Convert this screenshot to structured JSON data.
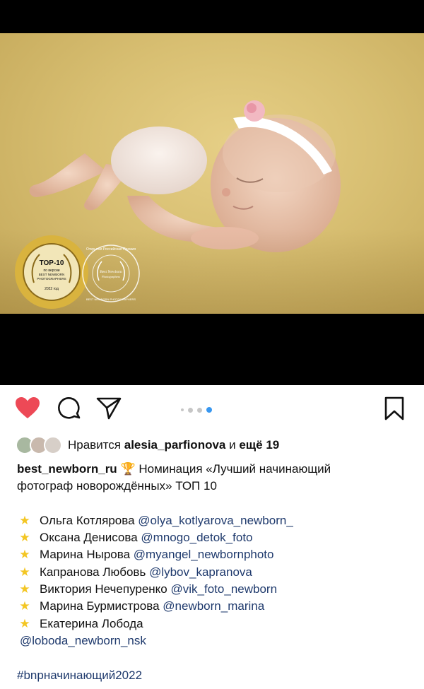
{
  "post": {
    "likes": {
      "prefix": "Нравится",
      "user": "alesia_parfionova",
      "conj": "и",
      "more": "ещё 19"
    },
    "caption": {
      "author": "best_newborn_ru",
      "emoji": "🏆",
      "title_line1": "Номинация «Лучший начинающий",
      "title_line2": "фотограф новорождённых» ТОП 10",
      "entries": [
        {
          "name": "Ольга Котлярова",
          "handle": "@olya_kotlyarova_newborn_"
        },
        {
          "name": "Оксана Денисова",
          "handle": "@mnogo_detok_foto"
        },
        {
          "name": "Марина Нырова",
          "handle": "@myangel_newbornphoto"
        },
        {
          "name": "Капранова Любовь",
          "handle": "@lybov_kapranova"
        },
        {
          "name": "Виктория Нечепуренко",
          "handle": "@vik_foto_newborn"
        },
        {
          "name": "Марина Бурмистрова",
          "handle": "@newborn_marina"
        },
        {
          "name": "Екатерина Лобода",
          "handle": "@loboda_newborn_nsk"
        }
      ],
      "hashtag": "#bnpначинающий2022"
    },
    "photo": {
      "badge_top": "TOP-10",
      "badge_line2": "по версии",
      "badge_line3": "BEST NEWBORN",
      "badge_line4": "PHOTOGRAPHERS",
      "badge_year": "2022 год",
      "seal_arc": "Открытая Российская Премия",
      "seal_center1": "Best Newborn",
      "seal_center2": "Photographers",
      "seal_bottom": "BEST NEWBORN PHOTOGRAPHERS"
    },
    "icons": {
      "like": "heart-icon",
      "comment": "comment-icon",
      "share": "send-icon",
      "save": "bookmark-icon"
    },
    "colors": {
      "like": "#ed4956",
      "carousel_active": "#3897f0",
      "mention": "#1f3a6d"
    },
    "carousel": {
      "count": 4,
      "active": 4
    }
  }
}
